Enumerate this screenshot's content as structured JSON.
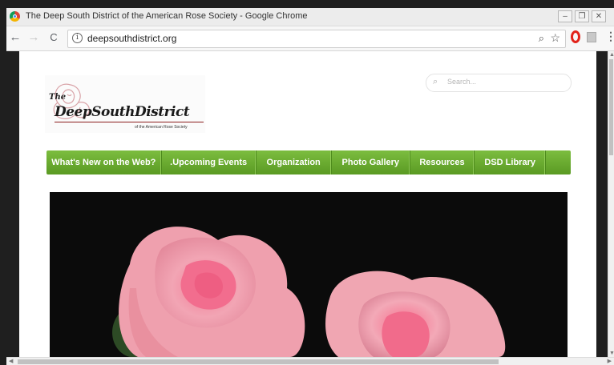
{
  "window": {
    "title": "The Deep South District of the American Rose Society - Google Chrome",
    "controls": {
      "minimize": "–",
      "restore": "❐",
      "close": "✕"
    }
  },
  "toolbar": {
    "back": "←",
    "forward": "→",
    "reload": "C",
    "url": "deepsouthdistrict.org",
    "menu": "⋮"
  },
  "site": {
    "logo": {
      "the": "The",
      "name": "DeepSouthDistrict",
      "subtitle": "of the American Rose Society"
    },
    "search": {
      "placeholder": "Search..."
    },
    "nav": [
      {
        "label": "What's New on the Web?"
      },
      {
        "label": ".Upcoming Events"
      },
      {
        "label": "Organization"
      },
      {
        "label": "Photo Gallery"
      },
      {
        "label": "Resources"
      },
      {
        "label": "DSD Library"
      }
    ]
  },
  "colors": {
    "nav_green": "#6aab2f",
    "logo_accent": "#8b1c1c",
    "hero_background": "#0b0b0b",
    "rose_pink": "#f2a0b0"
  }
}
